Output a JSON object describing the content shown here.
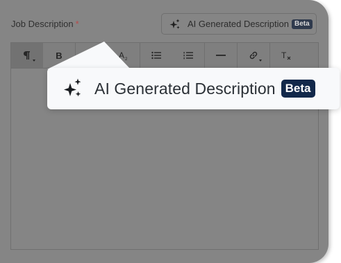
{
  "field": {
    "label": "Job Description",
    "required_mark": "*"
  },
  "ai_button": {
    "label": "AI Generated Description",
    "badge": "Beta",
    "icon": "sparkles-icon"
  },
  "toolbar": {
    "buttons": [
      {
        "name": "paragraph-format",
        "icon": "pilcrow-icon",
        "glyph": "¶",
        "has_dropdown": true
      },
      {
        "name": "bold",
        "icon": "bold-icon",
        "glyph": "B"
      },
      {
        "name": "superscript",
        "icon": "superscript-icon",
        "glyph": "A²"
      },
      {
        "name": "subscript",
        "icon": "subscript-icon",
        "glyph": "A₂"
      },
      {
        "name": "bulleted-list",
        "icon": "bullet-list-icon"
      },
      {
        "name": "numbered-list",
        "icon": "numbered-list-icon"
      },
      {
        "name": "horizontal-rule",
        "icon": "horizontal-rule-icon"
      },
      {
        "name": "link",
        "icon": "link-icon",
        "has_dropdown": true
      },
      {
        "name": "clear-formatting",
        "icon": "clear-format-icon",
        "glyph": "T"
      }
    ]
  },
  "callout": {
    "label": "AI Generated Description",
    "badge": "Beta"
  },
  "colors": {
    "overlay": "#858585",
    "beta_badge": "#12284a",
    "required": "#b94a4a"
  }
}
